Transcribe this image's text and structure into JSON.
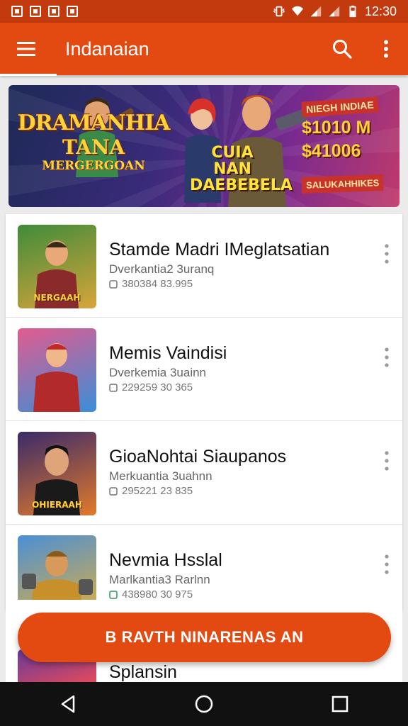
{
  "status_bar": {
    "time": "12:30",
    "icons": [
      "image-icon",
      "mail-icon",
      "app-icon",
      "lock-icon",
      "vibrate-icon",
      "wifi-icon",
      "signal-icon",
      "signal-icon",
      "battery-icon"
    ]
  },
  "app_bar": {
    "title": "Indanaian",
    "icons": [
      "menu-icon",
      "search-icon",
      "more-vert-icon"
    ]
  },
  "banner": {
    "left_line1": "DRAMANHIA",
    "left_line2": "TANA",
    "left_line3": "MERGERGOAN",
    "mid_line1": "CUIA NAN",
    "mid_line2": "DAEBEBELA",
    "right_tag": "NIEGH INDIAE",
    "right_price1": "$1010 M",
    "right_price2": "$41006",
    "right_sub": "SALUKAHHIKES"
  },
  "list": {
    "items": [
      {
        "title": "Stamde Madri IMeglatsatian",
        "subtitle": "Dverkantia2 3uranq",
        "meta": "380384 83.995",
        "thumb_text": "NERGAAH",
        "thumb_colors": [
          "#3f8b3a",
          "#d8a53a"
        ]
      },
      {
        "title": "Memis Vaindisi",
        "subtitle": "Dverkemia 3uainn",
        "meta": "229259 30 365",
        "thumb_text": "",
        "thumb_colors": [
          "#e25b8f",
          "#3a8fd8"
        ]
      },
      {
        "title": "GioaNohtai Siaupanos",
        "subtitle": "Merkuantia 3uahnn",
        "meta": "295221 23 835",
        "thumb_text": "OHIERAAH",
        "thumb_colors": [
          "#3a2a6a",
          "#e27a2a"
        ]
      },
      {
        "title": "Nevmia Hsslal",
        "subtitle": "Marlkantia3 Rarlnn",
        "meta": "438980 30 975",
        "thumb_text": "",
        "thumb_colors": [
          "#4a8fd8",
          "#e2b03a"
        ]
      }
    ],
    "partial_item_title": "Splansin"
  },
  "fab": {
    "label": "B RAVTH NINARENAS AN"
  },
  "nav_bar": {
    "icons": [
      "back-icon",
      "home-icon",
      "recents-icon"
    ]
  },
  "colors": {
    "primary": "#e24a12",
    "status_bar": "#c23a0e",
    "nav_bar": "#111111"
  }
}
